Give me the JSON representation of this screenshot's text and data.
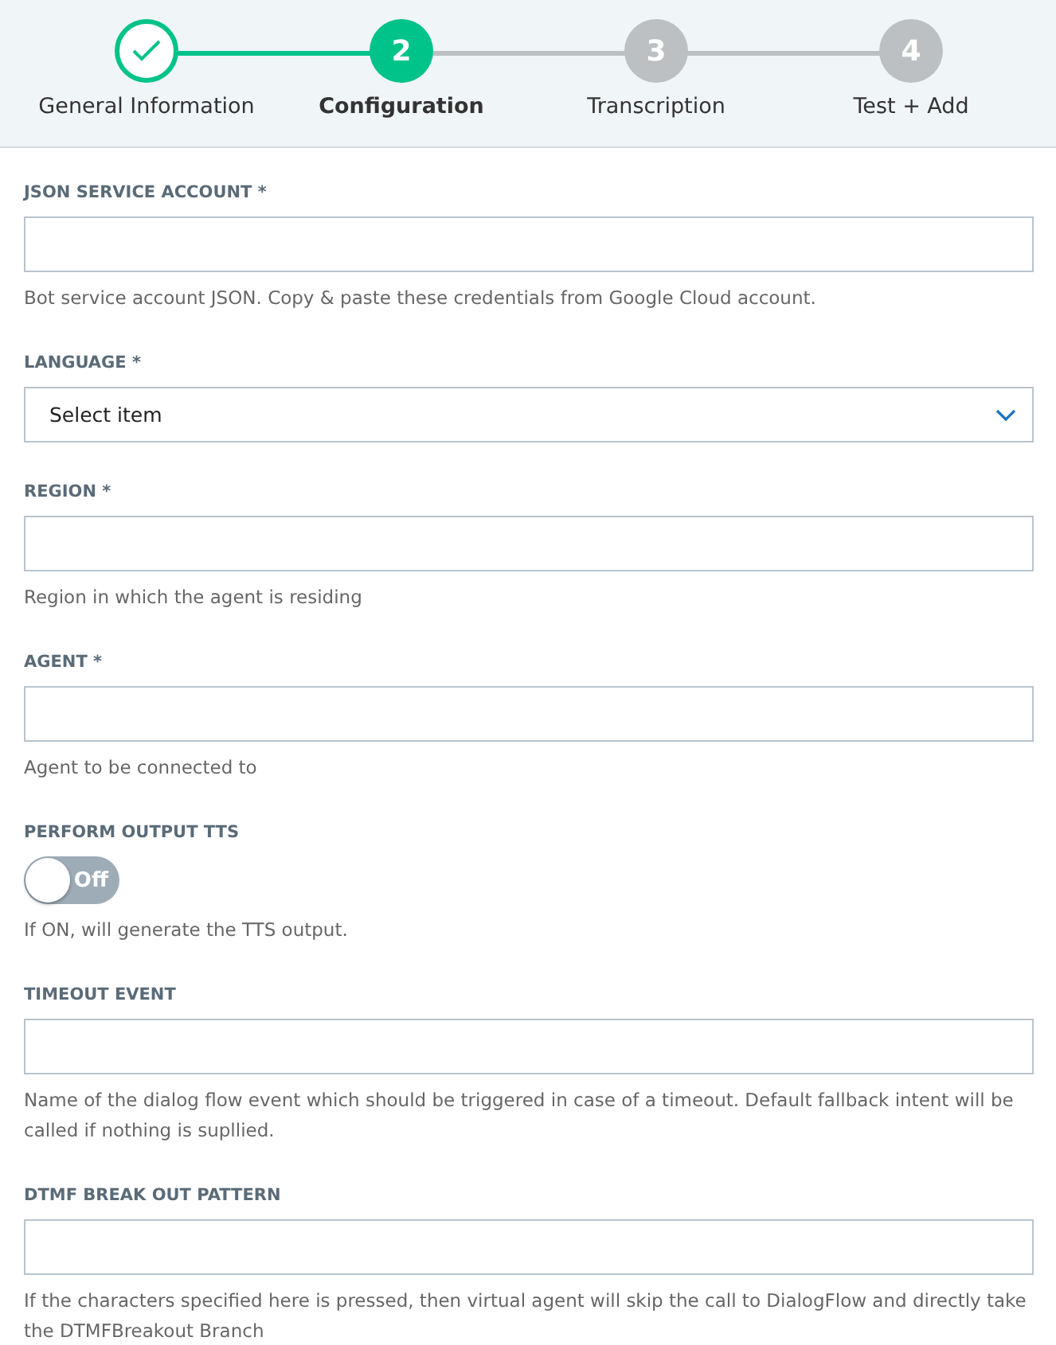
{
  "steps": [
    {
      "label": "General Information",
      "done": true,
      "selected": false
    },
    {
      "label": "Configuration",
      "number": "2",
      "done": false,
      "selected": true
    },
    {
      "label": "Transcription",
      "number": "3",
      "done": false,
      "selected": false
    },
    {
      "label": "Test + Add",
      "number": "4",
      "done": false,
      "selected": false
    }
  ],
  "fields": [
    {
      "kind": "text",
      "label": "JSON SERVICE ACCOUNT *",
      "help": "Bot service account JSON. Copy & paste these credentials from Google Cloud account."
    },
    {
      "kind": "select",
      "label": "LANGUAGE *",
      "value": "Select item"
    },
    {
      "kind": "text",
      "label": "REGION *",
      "help": "Region in which the agent is residing"
    },
    {
      "kind": "text",
      "label": "AGENT *",
      "help": "Agent to be connected to"
    },
    {
      "kind": "toggle",
      "label": "PERFORM OUTPUT TTS",
      "on": false,
      "state_text": "Off",
      "help": "If ON, will generate the TTS output."
    },
    {
      "kind": "text",
      "label": "TIMEOUT EVENT",
      "help": "Name of the dialog flow event which should be triggered in case of a timeout. Default fallback intent will be called if nothing is supllied."
    },
    {
      "kind": "text",
      "label": "DTMF BREAK OUT PATTERN",
      "help": "If the characters specified here is pressed, then virtual agent will skip the call to DialogFlow and directly take the DTMFBreakout Branch"
    }
  ]
}
